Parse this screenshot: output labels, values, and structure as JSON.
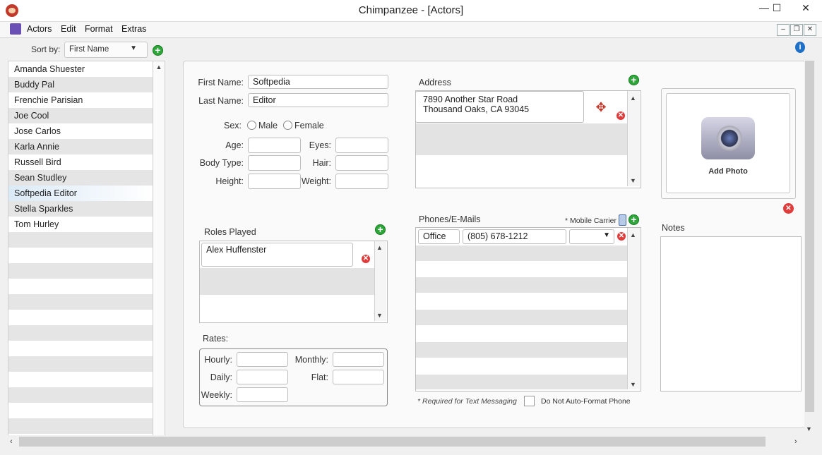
{
  "window": {
    "title": "Chimpanzee - [Actors]",
    "minimize": "—",
    "maximize": "☐",
    "close": "✕"
  },
  "menu": {
    "items": [
      "Actors",
      "Edit",
      "Format",
      "Extras"
    ]
  },
  "sidebar": {
    "sort_label": "Sort by:",
    "sort_value": "First Name",
    "actors": [
      "Amanda Shuester",
      "Buddy Pal",
      "Frenchie Parisian",
      "Joe Cool",
      "Jose Carlos",
      "Karla Annie",
      "Russell Bird",
      "Sean Studley",
      "Softpedia Editor",
      "Stella Sparkles",
      "Tom Hurley"
    ],
    "selected": "Softpedia Editor"
  },
  "form": {
    "first_name_label": "First Name:",
    "first_name": "Softpedia",
    "last_name_label": "Last Name:",
    "last_name": "Editor",
    "sex_label": "Sex:",
    "male": "Male",
    "female": "Female",
    "age_label": "Age:",
    "eyes_label": "Eyes:",
    "body_type_label": "Body Type:",
    "hair_label": "Hair:",
    "height_label": "Height:",
    "weight_label": "Weight:"
  },
  "roles": {
    "label": "Roles Played",
    "items": [
      "Alex Huffenster"
    ]
  },
  "rates": {
    "label": "Rates:",
    "hourly": "Hourly:",
    "monthly": "Monthly:",
    "daily": "Daily:",
    "flat": "Flat:",
    "weekly": "Weekly:"
  },
  "address": {
    "label": "Address",
    "line1": "7890 Another Star Road",
    "line2": "Thousand Oaks, CA 93045"
  },
  "phones": {
    "label": "Phones/E-Mails",
    "mobile_carrier": "* Mobile Carrier",
    "type": "Office",
    "number": "(805) 678-1212",
    "required_note": "* Required for Text Messaging",
    "no_autoformat": "Do Not Auto-Format Phone"
  },
  "photo": {
    "label": "Add Photo"
  },
  "notes": {
    "label": "Notes"
  },
  "colors": {
    "add_green": "#2ea63a",
    "delete_red": "#e03c3c",
    "selection": "#dbeaf7"
  }
}
